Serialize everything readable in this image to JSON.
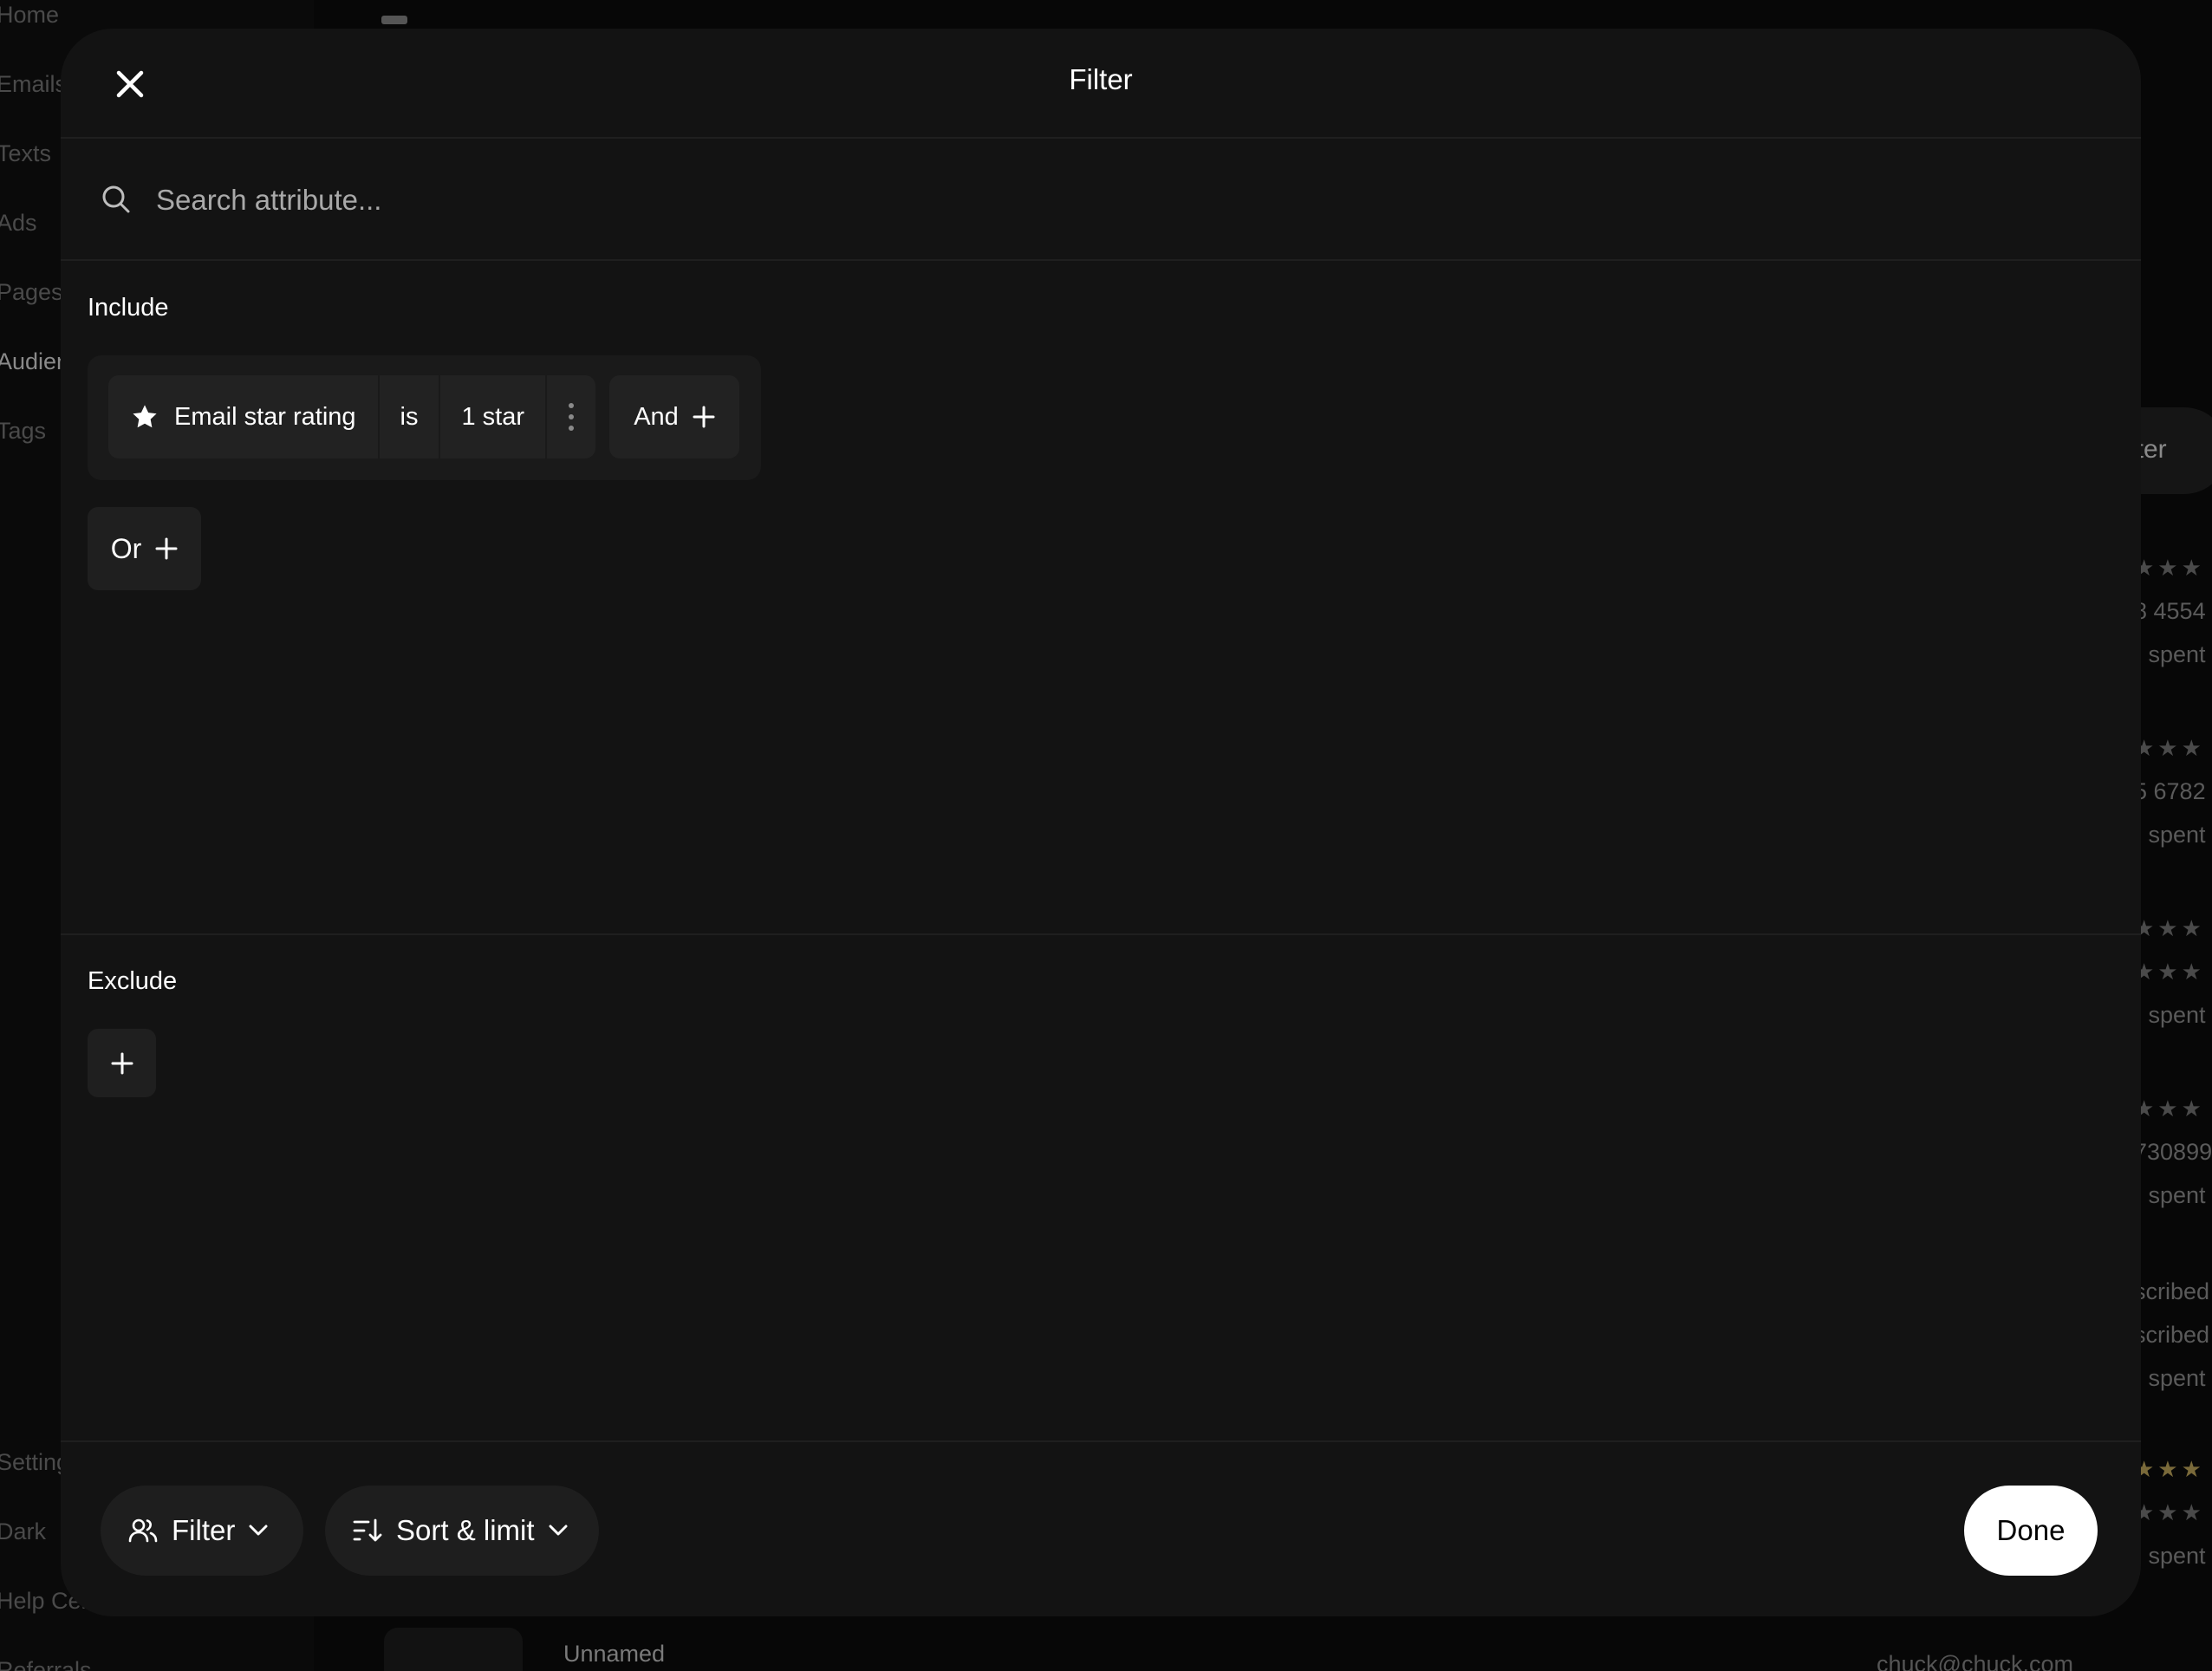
{
  "background": {
    "sidebar": {
      "items": [
        "Home",
        "Emails",
        "Texts",
        "Ads",
        "Pages",
        "Audien",
        "Tags",
        "Setting",
        "Dark",
        "Help Cen",
        "Referrals"
      ],
      "active_index": 5
    },
    "filter_button_partial": "lter",
    "rows": [
      {
        "phone": "8 4554",
        "spent": ") spent"
      },
      {
        "phone": "5 6782",
        "spent": ") spent"
      },
      {
        "phone": "",
        "spent": ") spent"
      },
      {
        "phone": "730899",
        "spent": ") spent"
      },
      {
        "subscribed_1": "scribed",
        "subscribed_2": "scribed",
        "spent": ") spent"
      },
      {
        "phone": "",
        "spent": ") spent"
      }
    ],
    "stars": "★★★",
    "unnamed_label": "Unnamed",
    "email_partial": "chuck@chuck.com"
  },
  "modal": {
    "title": "Filter",
    "search": {
      "placeholder": "Search attribute..."
    },
    "include": {
      "label": "Include",
      "condition": {
        "attribute": "Email star rating",
        "operator": "is",
        "value": "1 star"
      },
      "and_label": "And",
      "or_label": "Or"
    },
    "exclude": {
      "label": "Exclude"
    },
    "footer": {
      "filter_label": "Filter",
      "sort_label": "Sort & limit",
      "done_label": "Done"
    }
  },
  "colors": {
    "modal_bg": "#131313",
    "chip_bg": "#222222",
    "accent_done": "#ffffff"
  }
}
